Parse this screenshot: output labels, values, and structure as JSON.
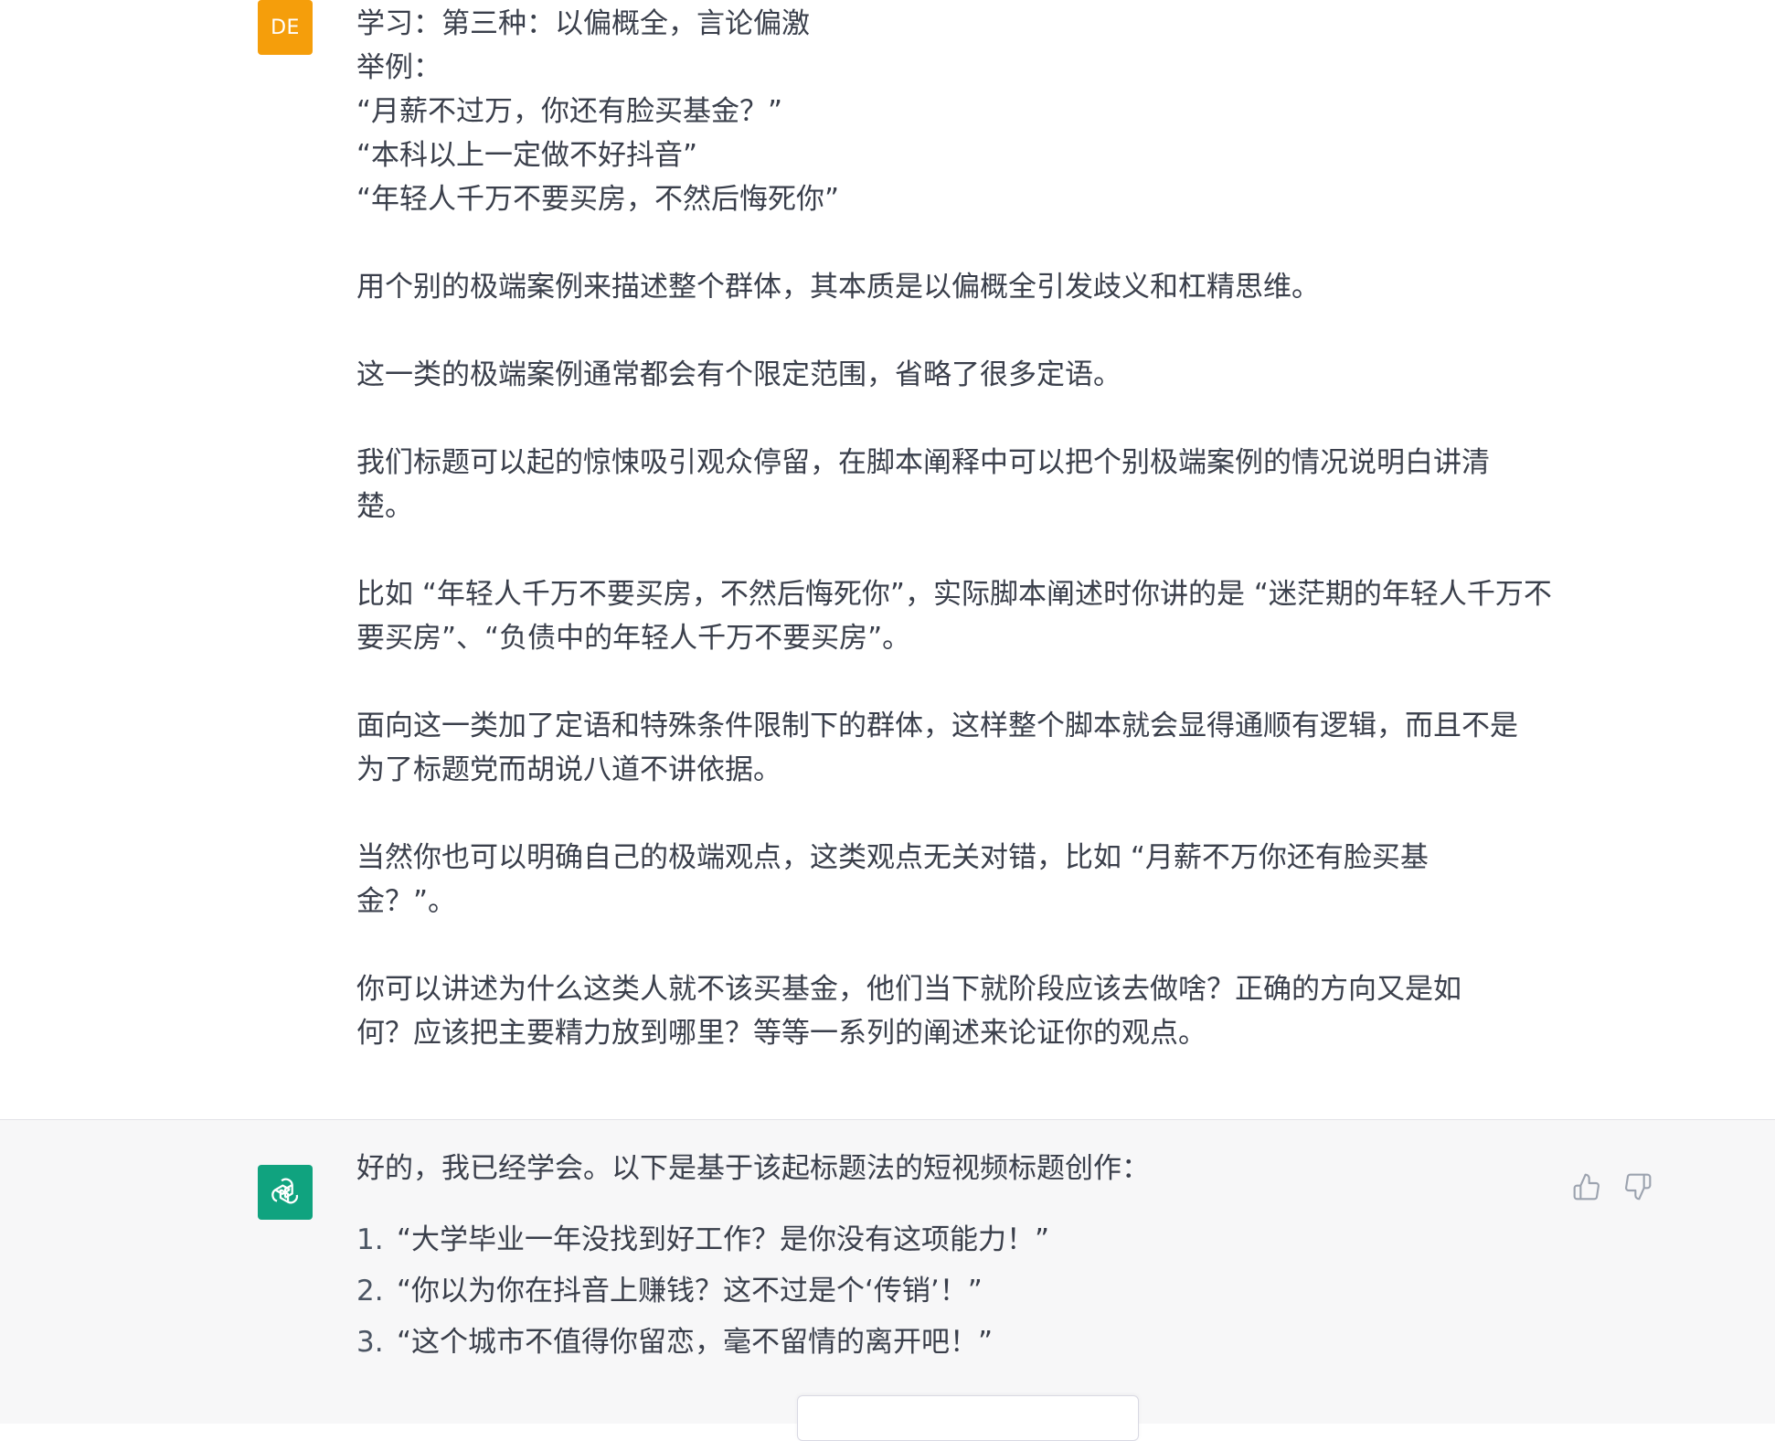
{
  "user": {
    "avatar_initials": "DE",
    "avatar_color": "#f59e0b",
    "lines": [
      "学习：第三种：以偏概全，言论偏激",
      "举例：",
      "“月薪不过万，你还有脸买基金？”",
      "“本科以上一定做不好抖音”",
      "“年轻人千万不要买房，不然后悔死你”"
    ],
    "paragraphs": [
      "用个别的极端案例来描述整个群体，其本质是以偏概全引发歧义和杠精思维。",
      "这一类的极端案例通常都会有个限定范围，省略了很多定语。",
      "我们标题可以起的惊悚吸引观众停留，在脚本阐释中可以把个别极端案例的情况说明白讲清楚。",
      "比如 “年轻人千万不要买房，不然后悔死你”，实际脚本阐述时你讲的是 “迷茫期的年轻人千万不要买房”、“负债中的年轻人千万不要买房”。",
      "面向这一类加了定语和特殊条件限制下的群体，这样整个脚本就会显得通顺有逻辑，而且不是为了标题党而胡说八道不讲依据。",
      "当然你也可以明确自己的极端观点，这类观点无关对错，比如 “月薪不万你还有脸买基金？”。",
      "你可以讲述为什么这类人就不该买基金，他们当下就阶段应该去做啥？正确的方向又是如何？应该把主要精力放到哪里？等等一系列的阐述来论证你的观点。"
    ]
  },
  "assistant": {
    "avatar_color": "#10a37f",
    "intro": "好的，我已经学会。以下是基于该起标题法的短视频标题创作：",
    "items": [
      {
        "num": "1.",
        "text": "“大学毕业一年没找到好工作？是你没有这项能力！”"
      },
      {
        "num": "2.",
        "text": "“你以为你在抖音上赚钱？这不过是个‘传销’！”"
      },
      {
        "num": "3.",
        "text": "“这个城市不值得你留恋，毫不留情的离开吧！”"
      }
    ]
  },
  "icons": {
    "thumbs_up": "thumbs-up-icon",
    "thumbs_down": "thumbs-down-icon",
    "bot_logo": "openai-logo-icon"
  }
}
